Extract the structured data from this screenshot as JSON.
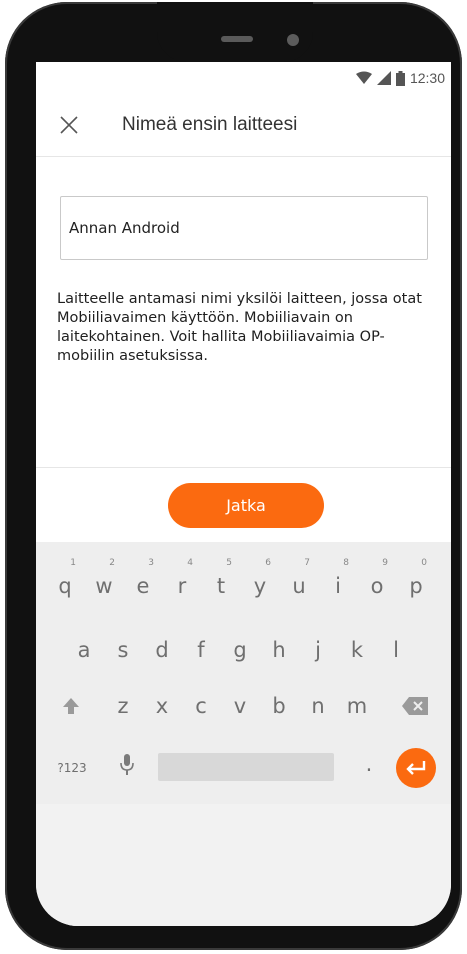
{
  "status_bar": {
    "time": "12:30",
    "icons": [
      "wifi-icon",
      "signal-icon",
      "battery-icon"
    ]
  },
  "header": {
    "close_icon": "close-icon",
    "title": "Nimeä ensin laitteesi"
  },
  "device_name_input": {
    "value": "Annan Android"
  },
  "help_text": {
    "lines": [
      "Laitteelle antamasi nimi yksilöi laitteen, jossa otat",
      "Mobiiliavaimen käyttöön. Mobiiliavain on",
      "laitekohtainen. Voit hallita Mobiiliavaimia OP-",
      "mobiilin asetuksissa."
    ]
  },
  "continue_button": {
    "label": "Jatka"
  },
  "keyboard": {
    "row1": [
      {
        "key": "q",
        "num": "1"
      },
      {
        "key": "w",
        "num": "2"
      },
      {
        "key": "e",
        "num": "3"
      },
      {
        "key": "r",
        "num": "4"
      },
      {
        "key": "t",
        "num": "5"
      },
      {
        "key": "y",
        "num": "6"
      },
      {
        "key": "u",
        "num": "7"
      },
      {
        "key": "i",
        "num": "8"
      },
      {
        "key": "o",
        "num": "9"
      },
      {
        "key": "p",
        "num": "0"
      }
    ],
    "row2": [
      "a",
      "s",
      "d",
      "f",
      "g",
      "h",
      "j",
      "k",
      "l"
    ],
    "row3": [
      "z",
      "x",
      "c",
      "v",
      "b",
      "n",
      "m"
    ],
    "symbols_label": "?123",
    "period": ".",
    "shift_icon": "shift-icon",
    "backspace_icon": "backspace-icon",
    "mic_icon": "microphone-icon",
    "enter_icon": "enter-icon"
  },
  "colors": {
    "accent": "#fb6a10",
    "keyboard_bg": "#eeeeee",
    "text": "#333333"
  }
}
